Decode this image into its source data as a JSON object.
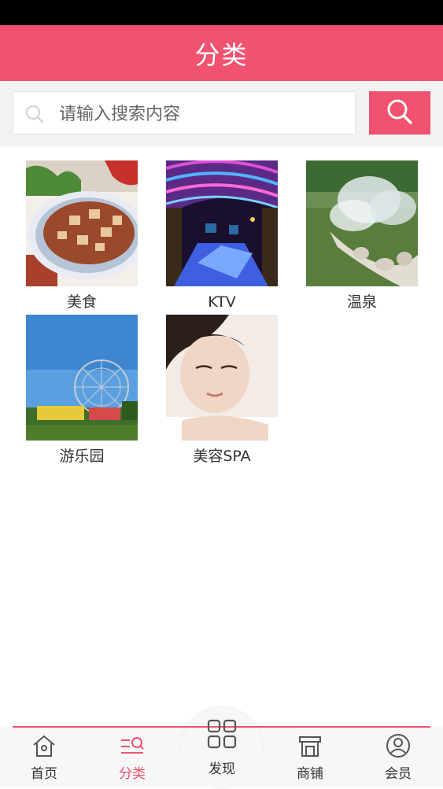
{
  "header": {
    "title": "分类"
  },
  "search": {
    "placeholder": "请输入搜索内容"
  },
  "categories": [
    {
      "label": "美食"
    },
    {
      "label": "KTV"
    },
    {
      "label": "温泉"
    },
    {
      "label": "游乐园"
    },
    {
      "label": "美容SPA"
    }
  ],
  "tabbar": {
    "items": [
      {
        "label": "首页",
        "icon": "home-icon"
      },
      {
        "label": "分类",
        "icon": "category-icon"
      },
      {
        "label": "发现",
        "icon": "grid-icon"
      },
      {
        "label": "商铺",
        "icon": "shop-icon"
      },
      {
        "label": "会员",
        "icon": "user-icon"
      }
    ],
    "active_index": 1
  },
  "colors": {
    "accent": "#f0526f",
    "text": "#333333"
  }
}
